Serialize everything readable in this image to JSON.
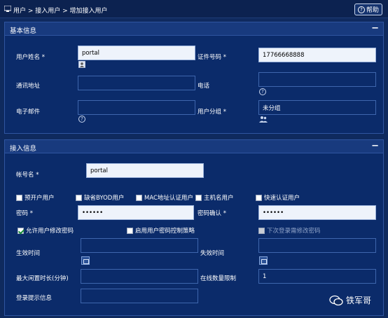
{
  "breadcrumb": "用户 > 接入用户 > 增加接入用户",
  "help_label": "帮助",
  "basic": {
    "title": "基本信息",
    "collapse": "−",
    "name_label": "用户姓名",
    "name_value": "portal",
    "id_label": "证件号码",
    "id_value": "17766668888",
    "address_label": "通讯地址",
    "phone_label": "电话",
    "email_label": "电子邮件",
    "group_label": "用户分组",
    "group_value": "未分组"
  },
  "access": {
    "title": "接入信息",
    "collapse": "−",
    "account_label": "帐号名",
    "account_value": "portal",
    "options": [
      "预开户用户",
      "缺省BYOD用户",
      "MAC地址认证用户",
      "主机名用户",
      "快速认证用户"
    ],
    "password_label": "密码",
    "password_value": "••••••",
    "confirm_label": "密码确认",
    "confirm_value": "••••••",
    "allow_change": "允许用户修改密码",
    "pwd_policy": "启用用户密码控制策略",
    "next_login": "下次登录需修改密码",
    "effective_label": "生效时间",
    "expire_label": "失效时间",
    "idle_label": "最大闲置时长(分钟)",
    "online_label": "在线数量限制",
    "online_value": "1",
    "login_tip_label": "登录提示信息"
  },
  "watermark": "铁军哥"
}
